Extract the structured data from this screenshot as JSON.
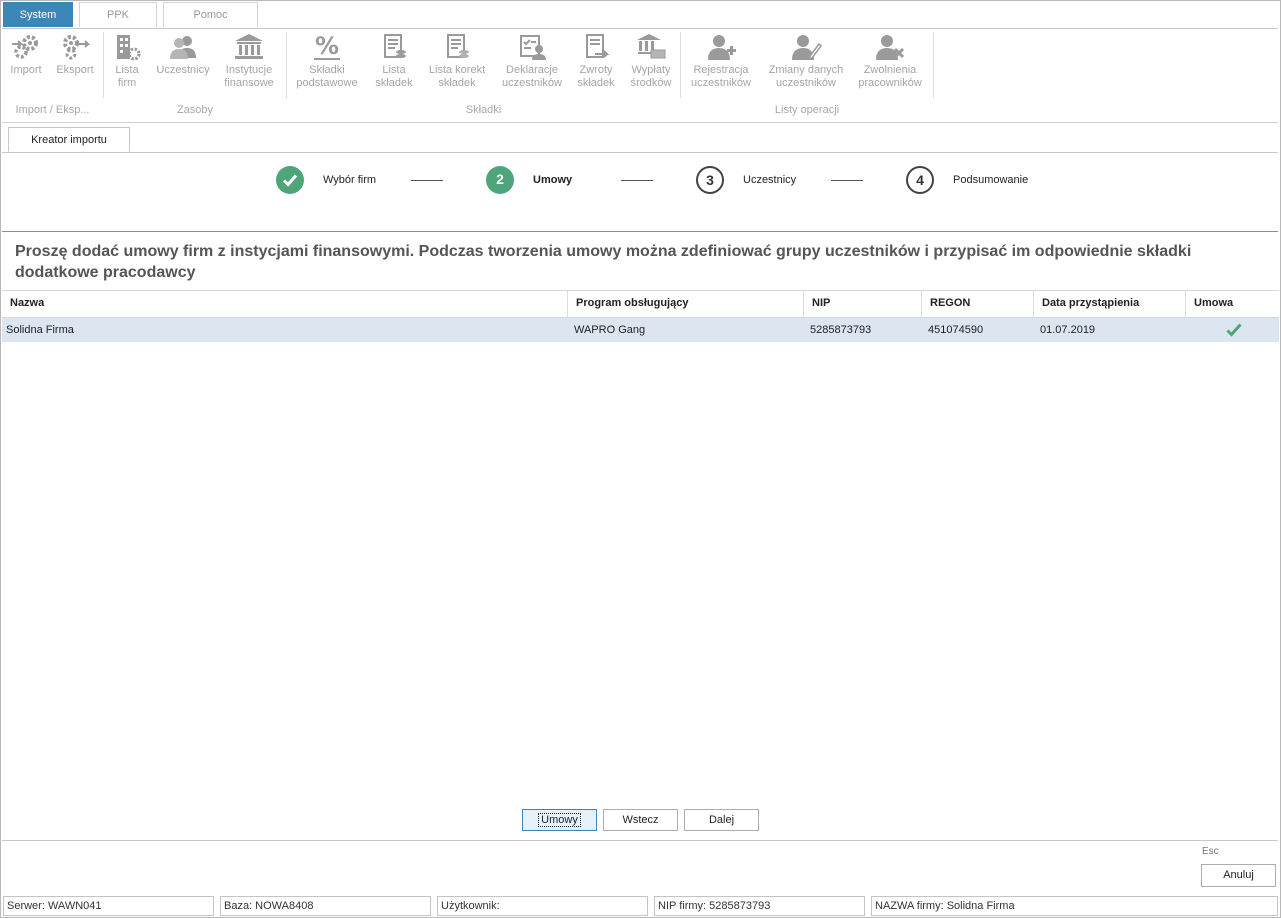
{
  "ribbon_tabs": [
    "System",
    "PPK",
    "Pomoc"
  ],
  "ribbon": {
    "groups": [
      "Import / Eksp...",
      "Zasoby",
      "Składki",
      "Listy operacji"
    ],
    "buttons": [
      {
        "label": "Import",
        "icon": "gears-arrow-in-icon"
      },
      {
        "label": "Eksport",
        "icon": "gears-arrow-out-icon"
      },
      {
        "label": "Lista\nfirm",
        "icon": "building-gear-icon"
      },
      {
        "label": "Uczestnicy",
        "icon": "users-icon"
      },
      {
        "label": "Instytucje\nfinansowe",
        "icon": "bank-icon"
      },
      {
        "label": "Składki\npodstawowe",
        "icon": "percent-icon"
      },
      {
        "label": "Lista\nskładek",
        "icon": "list-coins-icon"
      },
      {
        "label": "Lista korekt\nskładek",
        "icon": "list-correction-icon"
      },
      {
        "label": "Deklaracje\nuczestników",
        "icon": "declaration-icon"
      },
      {
        "label": "Zwroty\nskładek",
        "icon": "return-document-icon"
      },
      {
        "label": "Wypłaty\nśrodków",
        "icon": "payout-icon"
      },
      {
        "label": "Rejestracja\nuczestników",
        "icon": "user-add-icon"
      },
      {
        "label": "Zmiany danych\nuczestników",
        "icon": "user-edit-icon"
      },
      {
        "label": "Zwolnienia\npracowników",
        "icon": "user-remove-icon"
      }
    ]
  },
  "document_tab": "Kreator importu",
  "wizard": {
    "steps": [
      {
        "number": "1",
        "label": "Wybór firm",
        "state": "done"
      },
      {
        "number": "2",
        "label": "Umowy",
        "state": "current"
      },
      {
        "number": "3",
        "label": "Uczestnicy",
        "state": "todo"
      },
      {
        "number": "4",
        "label": "Podsumowanie",
        "state": "todo"
      }
    ],
    "instruction": "Proszę dodać umowy firm z instycjami finansowymi. Podczas tworzenia umowy można zdefiniować grupy uczestników i przypisać im odpowiednie składki dodatkowe pracodawcy"
  },
  "grid": {
    "columns": [
      "Nazwa",
      "Program obsługujący",
      "NIP",
      "REGON",
      "Data przystąpienia",
      "Umowa"
    ],
    "rows": [
      {
        "nazwa": "Solidna Firma",
        "program": "WAPRO Gang",
        "nip": "5285873793",
        "regon": "451074590",
        "data": "01.07.2019",
        "umowa": true
      }
    ]
  },
  "buttons": {
    "umowy": "Umowy",
    "wstecz": "Wstecz",
    "dalej": "Dalej",
    "esc_hint": "Esc",
    "anuluj": "Anuluj"
  },
  "status_bar": {
    "server": "Serwer: WAWN041",
    "database": "Baza: NOWA8408",
    "user": "Użytkownik:",
    "nip": "NIP firmy: 5285873793",
    "company": "NAZWA firmy: Solidna Firma"
  },
  "colors": {
    "accent": "#3d87b8",
    "success": "#4ea57a",
    "row_selected": "#dbe6f1",
    "disabled_text": "#a5a5a5"
  }
}
